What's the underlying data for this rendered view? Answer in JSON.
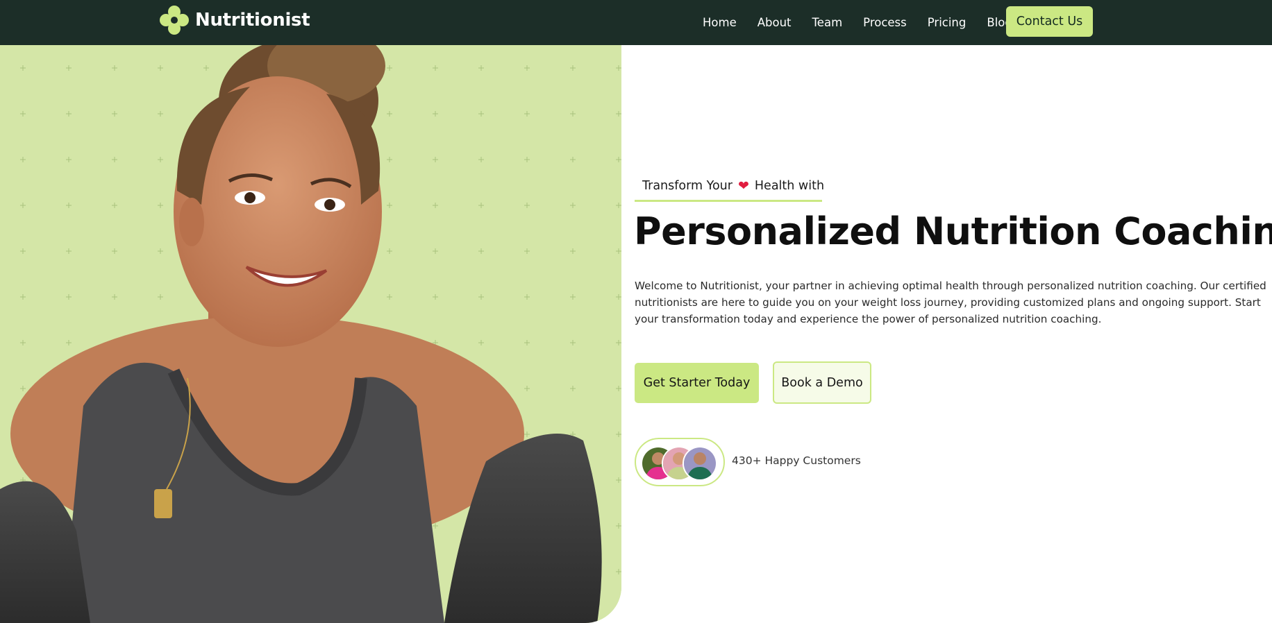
{
  "navbar": {
    "brand_name": "Nutritionist",
    "logo_icon": "clover-logo-icon",
    "links": [
      "Home",
      "About",
      "Team",
      "Process",
      "Pricing",
      "Blog"
    ],
    "contact_label": "Contact Us"
  },
  "hero": {
    "eyebrow_before": "Transform Your",
    "eyebrow_icon": "heart-icon",
    "eyebrow_after": "Health with",
    "headline": "Personalized Nutrition Coaching",
    "description": "Welcome to Nutritionist, your partner in achieving optimal health through personalized nutrition coaching. Our certified nutritionists are here to guide you on your weight loss journey, providing customized plans and ongoing support. Start your transformation today and experience the power of personalized nutrition coaching.",
    "primary_button": "Get Starter Today",
    "secondary_button": "Book a Demo",
    "customers_text": "430+ Happy Customers"
  },
  "colors": {
    "nav_background": "#1c2e28",
    "accent": "#cbe883",
    "hero_panel": "#d4e6a7",
    "heading": "#0f0f0f"
  }
}
